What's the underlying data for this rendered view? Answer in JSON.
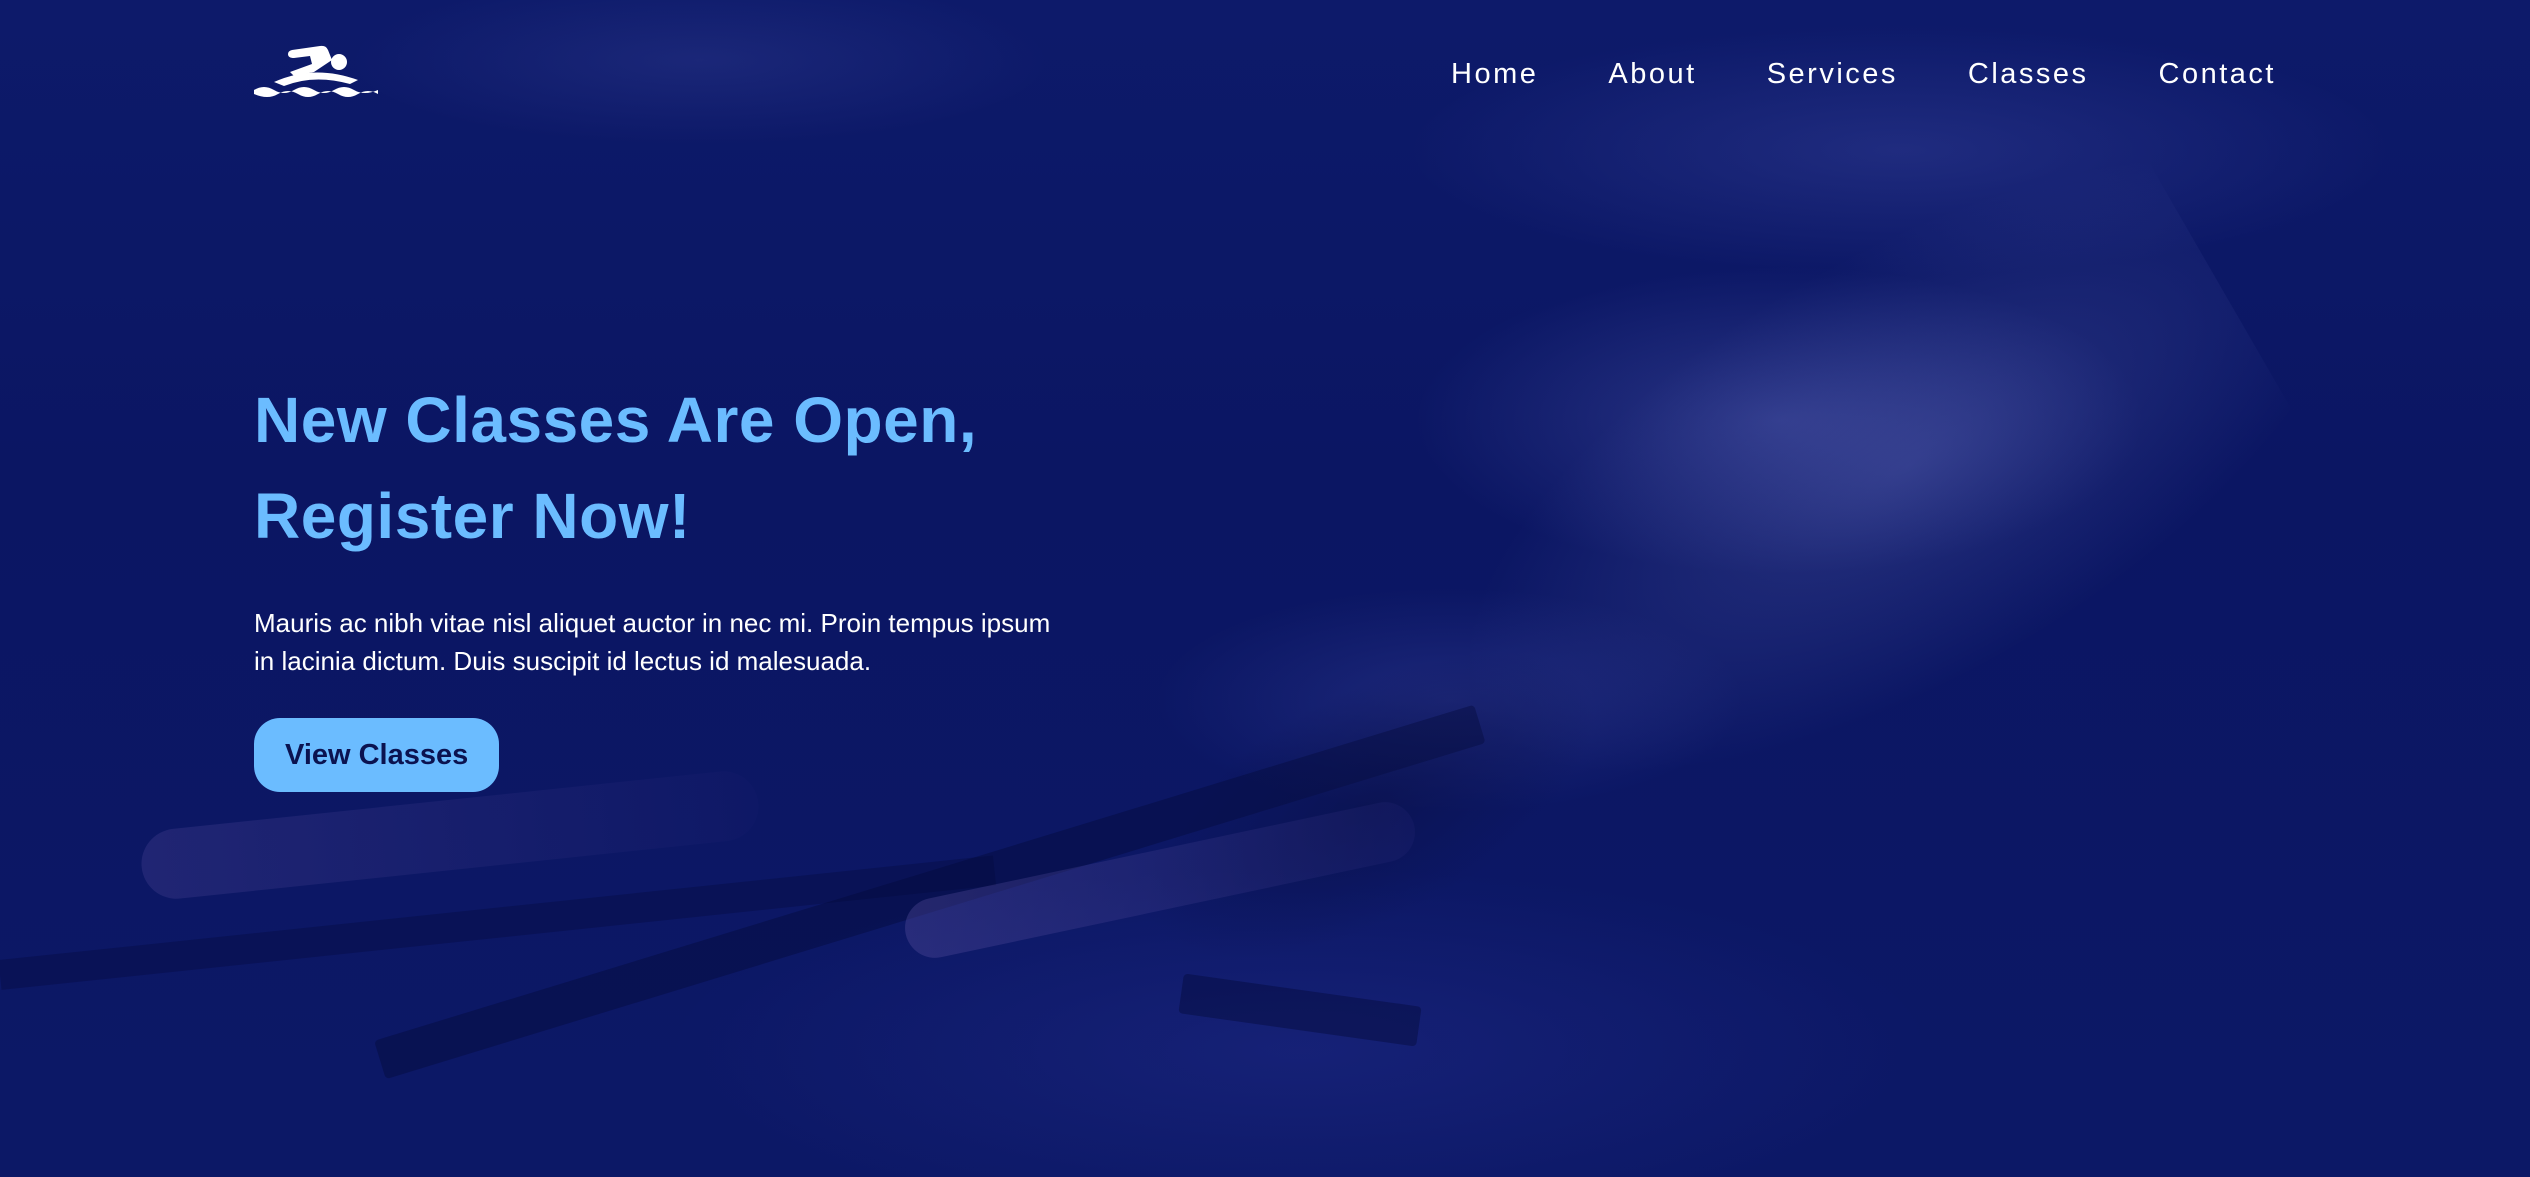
{
  "logo": {
    "icon": "swimmer-icon"
  },
  "nav": {
    "items": [
      {
        "label": "Home"
      },
      {
        "label": "About"
      },
      {
        "label": "Services"
      },
      {
        "label": "Classes"
      },
      {
        "label": "Contact"
      }
    ]
  },
  "hero": {
    "headline_line1": "New Classes Are Open,",
    "headline_line2": "Register Now!",
    "description_line1": "Mauris ac nibh vitae nisl aliquet auctor in nec mi. Proin tempus ipsum",
    "description_line2": "in lacinia dictum. Duis suscipit id lectus id malesuada.",
    "cta_label": "View Classes",
    "background": "underwater-swimmer-photo"
  },
  "colors": {
    "background": "#0b1662",
    "accent": "#6bbcff",
    "nav_text": "#ffffff",
    "cta_text": "#0b1350"
  }
}
